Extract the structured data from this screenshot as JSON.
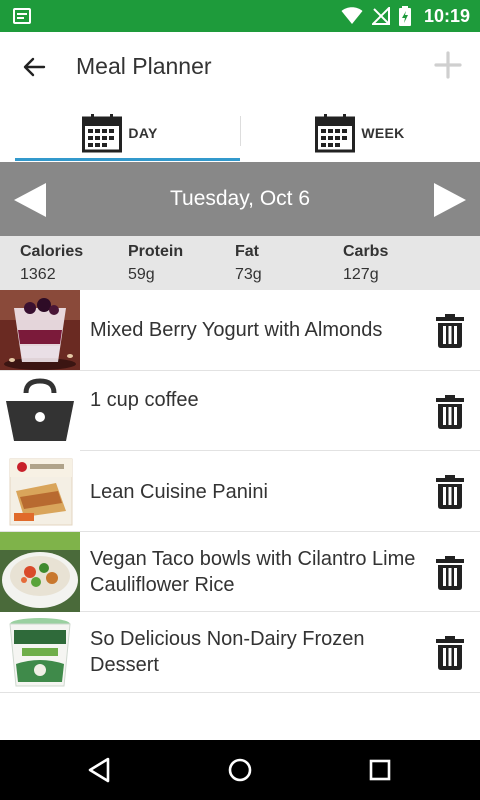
{
  "status_bar": {
    "time": "10:19"
  },
  "app_bar": {
    "title": "Meal Planner"
  },
  "tabs": [
    {
      "label": "DAY",
      "selected": true
    },
    {
      "label": "WEEK",
      "selected": false
    }
  ],
  "date_nav": {
    "date": "Tuesday, Oct 6"
  },
  "nutrition": [
    {
      "label": "Calories",
      "value": "1362"
    },
    {
      "label": "Protein",
      "value": "59g"
    },
    {
      "label": "Fat",
      "value": "73g"
    },
    {
      "label": "Carbs",
      "value": "127g"
    }
  ],
  "meals": [
    {
      "name": "Mixed Berry Yogurt with Almonds",
      "thumb": "yogurt-parfait-image"
    },
    {
      "name": "1 cup coffee",
      "thumb": "basket-placeholder-icon"
    },
    {
      "name": "Lean Cuisine Panini",
      "thumb": "lean-cuisine-box-image"
    },
    {
      "name": "Vegan Taco bowls with Cilantro Lime Cauliflower Rice",
      "thumb": "taco-bowl-image"
    },
    {
      "name": "So Delicious Non-Dairy Frozen Dessert",
      "thumb": "frozen-dessert-pint-image"
    }
  ],
  "colors": {
    "status_bar": "#1e9b3b",
    "tab_indicator": "#3399cc",
    "date_bar": "#888888",
    "nutrition_bar": "#e6e6e6"
  }
}
